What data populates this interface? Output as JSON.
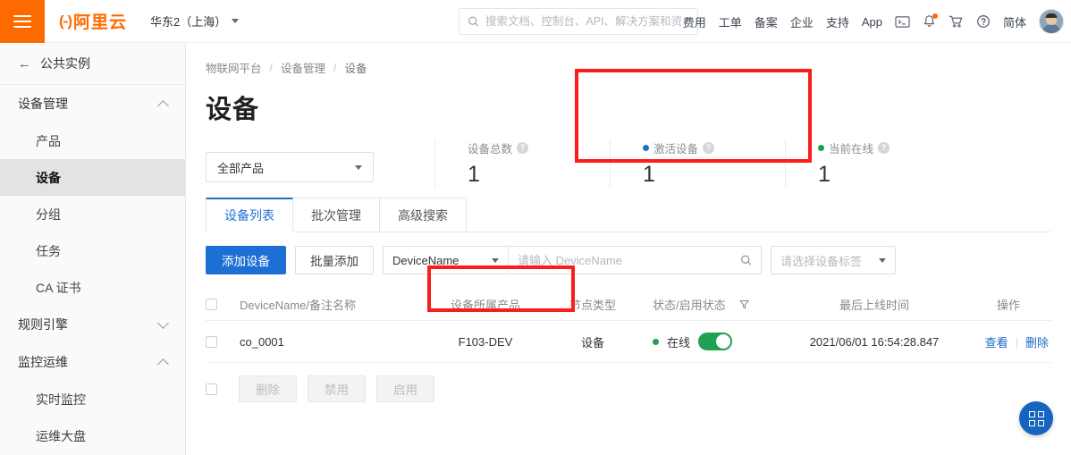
{
  "topbar": {
    "menu_icon": "hamburger-icon",
    "brand_mark": "(-)",
    "brand_text": "阿里云",
    "region": "华东2（上海）",
    "search_placeholder": "搜索文档、控制台、API、解决方案和资",
    "search_value": "",
    "search_icon": "search-icon",
    "links": [
      "费用",
      "工单",
      "备案",
      "企业",
      "支持",
      "App"
    ],
    "icons": [
      "console-icon",
      "bell-icon",
      "cart-icon",
      "help-icon"
    ],
    "language": "简体",
    "avatar": "user-avatar"
  },
  "sidebar": {
    "back_label": "公共实例",
    "groups": [
      {
        "label": "设备管理",
        "expanded": true,
        "items": [
          {
            "label": "产品",
            "active": false
          },
          {
            "label": "设备",
            "active": true
          },
          {
            "label": "分组",
            "active": false
          },
          {
            "label": "任务",
            "active": false
          },
          {
            "label": "CA 证书",
            "active": false
          }
        ]
      },
      {
        "label": "规则引擎",
        "expanded": false,
        "items": []
      },
      {
        "label": "监控运维",
        "expanded": true,
        "items": [
          {
            "label": "实时监控",
            "active": false
          },
          {
            "label": "运维大盘",
            "active": false
          }
        ]
      }
    ]
  },
  "breadcrumb": [
    "物联网平台",
    "设备管理",
    "设备"
  ],
  "page_title": "设备",
  "filters": {
    "product_select": "全部产品"
  },
  "stats": [
    {
      "label": "设备总数",
      "value": "1",
      "dot_color": "",
      "help": "?"
    },
    {
      "label": "激活设备",
      "value": "1",
      "dot_color": "#1a73c7",
      "help": "?"
    },
    {
      "label": "当前在线",
      "value": "1",
      "dot_color": "#1ba14f",
      "help": "?"
    }
  ],
  "tabs": [
    {
      "label": "设备列表",
      "active": true
    },
    {
      "label": "批次管理",
      "active": false
    },
    {
      "label": "高级搜索",
      "active": false
    }
  ],
  "toolbar": {
    "add_device": "添加设备",
    "batch_add": "批量添加",
    "search_field": "DeviceName",
    "search_placeholder": "请输入 DeviceName",
    "search_value": "",
    "tag_select": "请选择设备标签"
  },
  "table": {
    "headers": [
      "DeviceName/备注名称",
      "设备所属产品",
      "节点类型",
      "状态/启用状态",
      "最后上线时间",
      "操作"
    ],
    "rows": [
      {
        "device_name": "co_0001",
        "product": "F103-DEV",
        "node_type": "设备",
        "status": "在线",
        "status_dot": "#1ba14f",
        "enabled": true,
        "last_online": "2021/06/01 16:54:28.847",
        "actions": [
          "查看",
          "删除"
        ]
      }
    ]
  },
  "bottom_actions": [
    {
      "label": "删除",
      "disabled": true
    },
    {
      "label": "禁用",
      "disabled": true
    },
    {
      "label": "启用",
      "disabled": true
    }
  ],
  "fab": {
    "icon": "grid-apps-icon"
  },
  "annotations": [
    {
      "name": "online-stat-highlight",
      "color": "#fc1c1c"
    },
    {
      "name": "device-status-highlight",
      "color": "#fc1c1c"
    }
  ]
}
